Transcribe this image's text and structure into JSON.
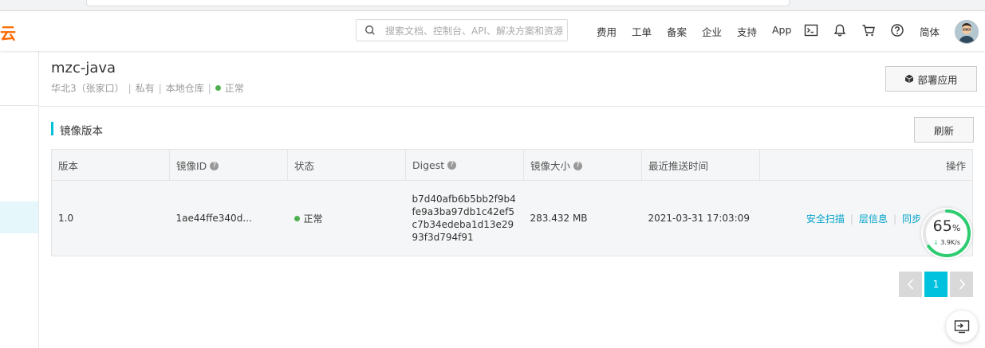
{
  "header": {
    "logo_text": "云",
    "search_placeholder": "搜索文档、控制台、API、解决方案和资源",
    "nav": [
      "费用",
      "工单",
      "备案",
      "企业",
      "支持",
      "App"
    ],
    "language": "简体"
  },
  "repo": {
    "name": "mzc-java",
    "region": "华北3（张家口）",
    "visibility": "私有",
    "source": "本地仓库",
    "status": "正常",
    "deploy_label": "部署应用"
  },
  "section": {
    "title": "镜像版本",
    "refresh_label": "刷新"
  },
  "table": {
    "columns": [
      "版本",
      "镜像ID",
      "状态",
      "Digest",
      "镜像大小",
      "最近推送时间",
      "操作"
    ],
    "rows": [
      {
        "version": "1.0",
        "image_id": "1ae44ffe340d...",
        "status": "正常",
        "digest": "b7d40afb6b5bb2f9b4fe9a3ba97db1c42ef5c7b34edeba1d13e2993f3d794f91",
        "size": "283.432 MB",
        "pushed_at": "2021-03-31 17:03:09",
        "actions": [
          "安全扫描",
          "层信息",
          "同步"
        ]
      }
    ]
  },
  "pagination": {
    "current": "1",
    "prev_icon": "chevron-left-icon",
    "next_icon": "chevron-right-icon"
  },
  "speed_widget": {
    "percent": "65",
    "percent_unit": "%",
    "rate": "3.9K/s",
    "progress": 0.65
  },
  "colors": {
    "brand": "#ff6a00",
    "accent": "#00c1de",
    "link": "#00a2ca",
    "status_ok": "#4caf50"
  }
}
